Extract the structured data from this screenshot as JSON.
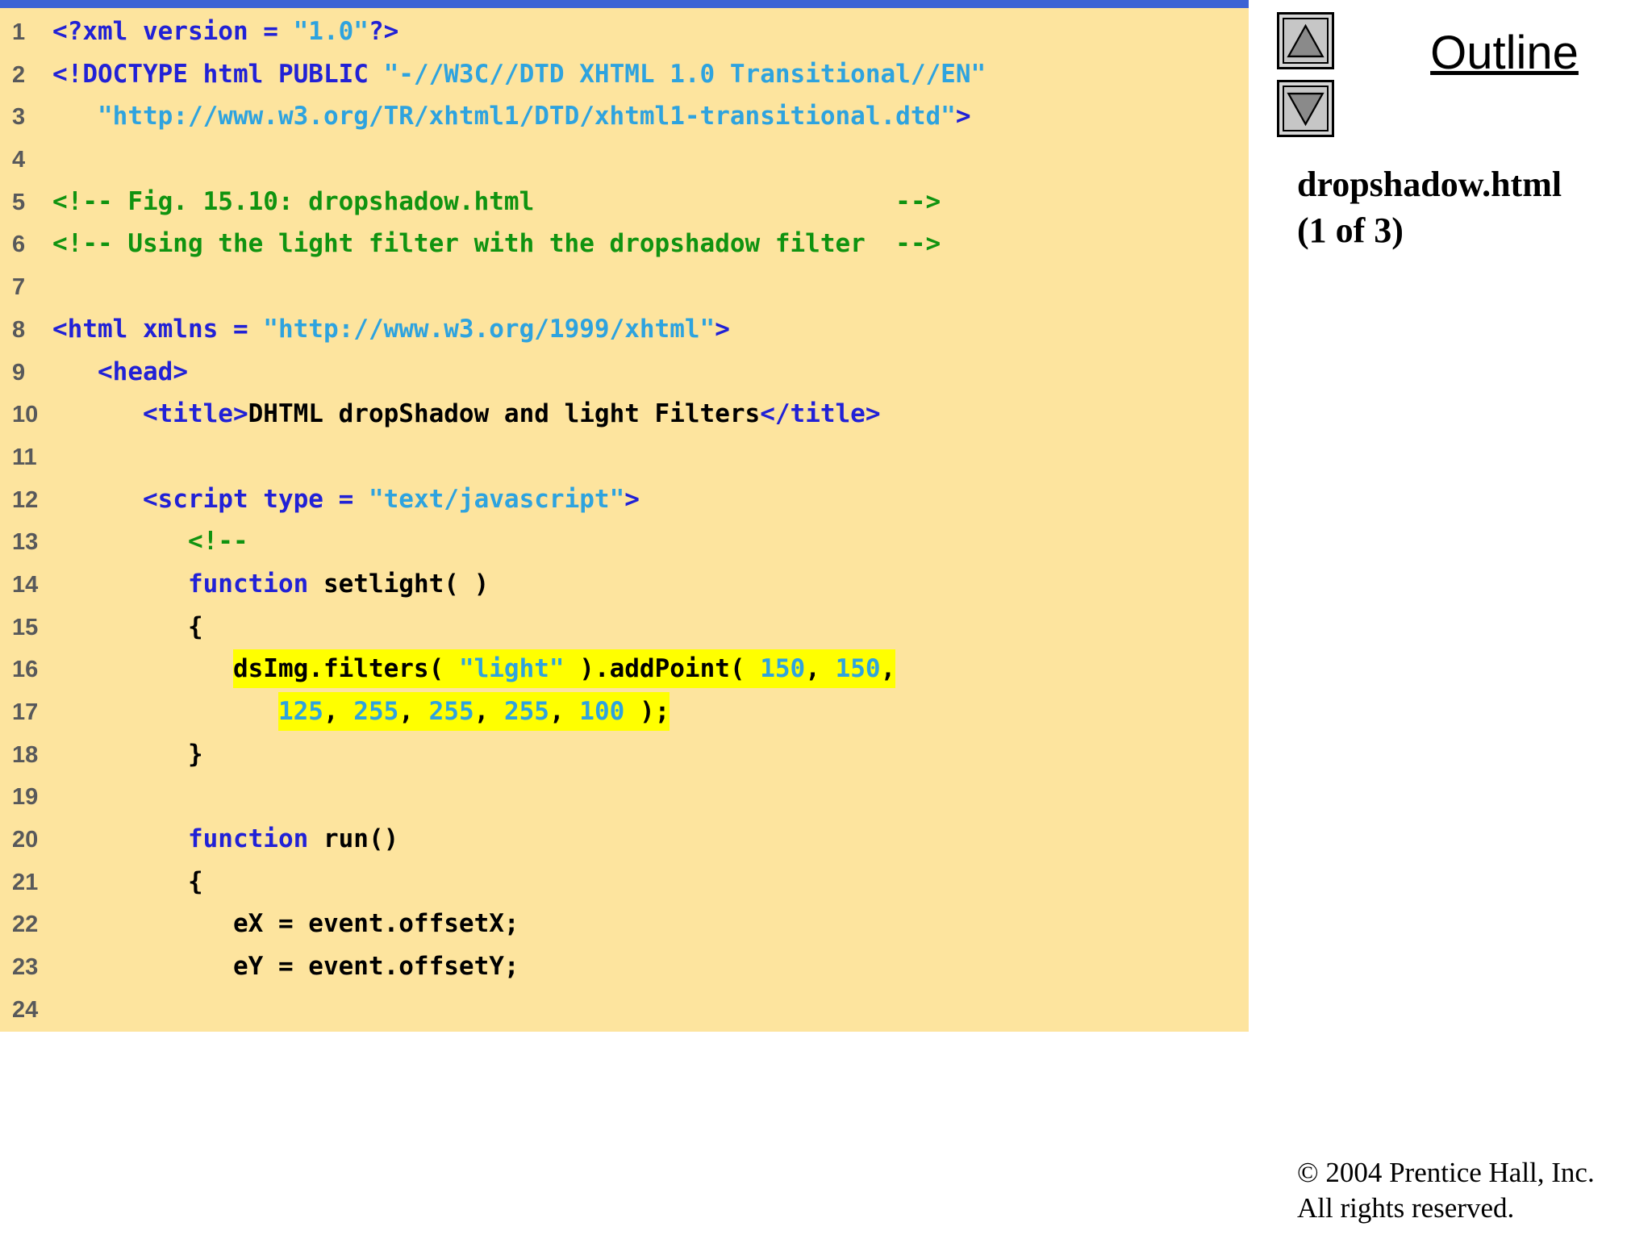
{
  "colors": {
    "top_bar": "#3C63D4",
    "code_panel_bg": "#FDE49E",
    "highlight": "#FFFF00",
    "keyword": "#2121D6",
    "string_and_number": "#2EA3DF",
    "comment": "#109310",
    "plain_code": "#000000",
    "line_number": "#58595B",
    "button_face": "#C6C6C6",
    "triangle": "#8A8A8A"
  },
  "outline": {
    "title": "Outline",
    "up_icon": "up-arrow-icon",
    "down_icon": "down-arrow-icon",
    "file_title_line1": "dropshadow.html",
    "file_title_line2": "(1 of 3)"
  },
  "footer": {
    "line1": "© 2004 Prentice Hall, Inc.",
    "line2": "All rights reserved."
  },
  "code": {
    "lines": [
      {
        "n": "1",
        "seg": [
          {
            "t": "<?xml version = ",
            "c": "kw"
          },
          {
            "t": "\"1.0\"",
            "c": "str"
          },
          {
            "t": "?>",
            "c": "kw"
          }
        ]
      },
      {
        "n": "2",
        "seg": [
          {
            "t": "<!DOCTYPE html PUBLIC ",
            "c": "kw"
          },
          {
            "t": "\"-//W3C//DTD XHTML 1.0 Transitional//EN\"",
            "c": "str"
          }
        ]
      },
      {
        "n": "3",
        "seg": [
          {
            "t": "   ",
            "c": "txt"
          },
          {
            "t": "\"http://www.w3.org/TR/xhtml1/DTD/xhtml1-transitional.dtd\"",
            "c": "str"
          },
          {
            "t": ">",
            "c": "kw"
          }
        ]
      },
      {
        "n": "4",
        "seg": []
      },
      {
        "n": "5",
        "seg": [
          {
            "t": "<!-- Fig. 15.10: dropshadow.html                        -->",
            "c": "com"
          }
        ]
      },
      {
        "n": "6",
        "seg": [
          {
            "t": "<!-- Using the light filter with the dropshadow filter  -->",
            "c": "com"
          }
        ]
      },
      {
        "n": "7",
        "seg": []
      },
      {
        "n": "8",
        "seg": [
          {
            "t": "<html xmlns = ",
            "c": "kw"
          },
          {
            "t": "\"http://www.w3.org/1999/xhtml\"",
            "c": "str"
          },
          {
            "t": ">",
            "c": "kw"
          }
        ]
      },
      {
        "n": "9",
        "seg": [
          {
            "t": "   ",
            "c": "txt"
          },
          {
            "t": "<head>",
            "c": "kw"
          }
        ]
      },
      {
        "n": "10",
        "seg": [
          {
            "t": "      ",
            "c": "txt"
          },
          {
            "t": "<title>",
            "c": "kw"
          },
          {
            "t": "DHTML dropShadow and light Filters",
            "c": "txt"
          },
          {
            "t": "</title>",
            "c": "kw"
          }
        ]
      },
      {
        "n": "11",
        "seg": []
      },
      {
        "n": "12",
        "seg": [
          {
            "t": "      ",
            "c": "txt"
          },
          {
            "t": "<script type = ",
            "c": "kw"
          },
          {
            "t": "\"text/javascript\"",
            "c": "str"
          },
          {
            "t": ">",
            "c": "kw"
          }
        ]
      },
      {
        "n": "13",
        "seg": [
          {
            "t": "         ",
            "c": "txt"
          },
          {
            "t": "<!--",
            "c": "com"
          }
        ]
      },
      {
        "n": "14",
        "seg": [
          {
            "t": "         ",
            "c": "txt"
          },
          {
            "t": "function",
            "c": "kw"
          },
          {
            "t": " setlight( )",
            "c": "txt"
          }
        ]
      },
      {
        "n": "15",
        "seg": [
          {
            "t": "         {",
            "c": "txt"
          }
        ]
      },
      {
        "n": "16",
        "seg": [
          {
            "t": "            ",
            "c": "txt"
          },
          {
            "t": "dsImg.filters( ",
            "c": "txt",
            "h": true
          },
          {
            "t": "\"light\"",
            "c": "str",
            "h": true
          },
          {
            "t": " ).addPoint( ",
            "c": "txt",
            "h": true
          },
          {
            "t": "150",
            "c": "num",
            "h": true
          },
          {
            "t": ", ",
            "c": "txt",
            "h": true
          },
          {
            "t": "150",
            "c": "num",
            "h": true
          },
          {
            "t": ",",
            "c": "txt",
            "h": true
          }
        ]
      },
      {
        "n": "17",
        "seg": [
          {
            "t": "               ",
            "c": "txt"
          },
          {
            "t": "125",
            "c": "num",
            "h": true
          },
          {
            "t": ", ",
            "c": "txt",
            "h": true
          },
          {
            "t": "255",
            "c": "num",
            "h": true
          },
          {
            "t": ", ",
            "c": "txt",
            "h": true
          },
          {
            "t": "255",
            "c": "num",
            "h": true
          },
          {
            "t": ", ",
            "c": "txt",
            "h": true
          },
          {
            "t": "255",
            "c": "num",
            "h": true
          },
          {
            "t": ", ",
            "c": "txt",
            "h": true
          },
          {
            "t": "100",
            "c": "num",
            "h": true
          },
          {
            "t": " );",
            "c": "txt",
            "h": true
          }
        ]
      },
      {
        "n": "18",
        "seg": [
          {
            "t": "         }",
            "c": "txt"
          }
        ]
      },
      {
        "n": "19",
        "seg": []
      },
      {
        "n": "20",
        "seg": [
          {
            "t": "         ",
            "c": "txt"
          },
          {
            "t": "function",
            "c": "kw"
          },
          {
            "t": " run()",
            "c": "txt"
          }
        ]
      },
      {
        "n": "21",
        "seg": [
          {
            "t": "         {",
            "c": "txt"
          }
        ]
      },
      {
        "n": "22",
        "seg": [
          {
            "t": "            eX = event.offsetX;",
            "c": "txt"
          }
        ]
      },
      {
        "n": "23",
        "seg": [
          {
            "t": "            eY = event.offsetY;",
            "c": "txt"
          }
        ]
      },
      {
        "n": "24",
        "seg": []
      }
    ]
  }
}
